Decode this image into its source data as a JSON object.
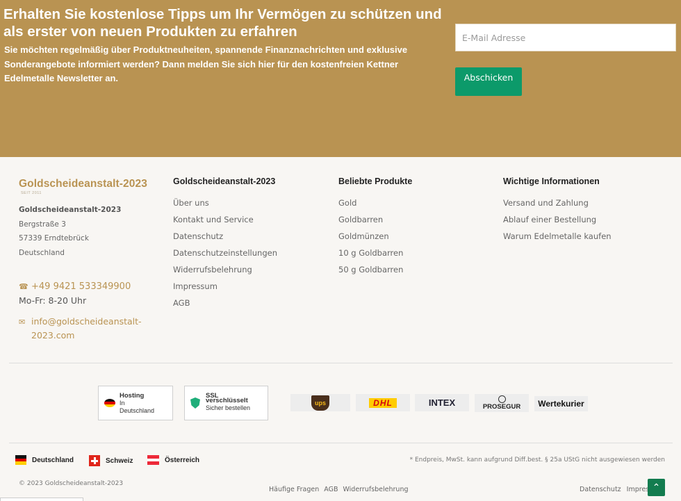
{
  "newsletter": {
    "title": "Erhalten Sie kostenlose Tipps um Ihr Vermögen zu schützen und als erster von neuen Produkten zu erfahren",
    "text": "Sie möchten regelmäßig über Produktneuheiten, spannende Finanznachrichten und exklusive Sonderangebote informiert werden? Dann melden Sie sich hier für den kostenfreien Kettner Edelmetalle Newsletter an.",
    "email_placeholder": "E-Mail Adresse",
    "submit_label": "Abschicken"
  },
  "brand": {
    "logo_name": "Goldscheideanstalt-2023",
    "logo_sub": "SEIT 2011",
    "company": "Goldscheideanstalt-2023",
    "street": "Bergstraße 3",
    "city": "57339 Erndtebrück",
    "country": "Deutschland",
    "phone": "+49 9421 533349900",
    "hours": "Mo-Fr: 8-20 Uhr",
    "email": "info@goldscheideanstalt-2023.com"
  },
  "columns": [
    {
      "title": "Goldscheideanstalt-2023",
      "links": [
        "Über uns",
        "Kontakt und Service",
        "Datenschutz",
        "Datenschutzeinstellungen",
        "Widerrufsbelehrung",
        "Impressum",
        "AGB"
      ]
    },
    {
      "title": "Beliebte Produkte",
      "links": [
        "Gold",
        "Goldbarren",
        "Goldmünzen",
        "10 g Goldbarren",
        "50 g Goldbarren"
      ]
    },
    {
      "title": "Wichtige Informationen",
      "links": [
        "Versand und Zahlung",
        "Ablauf einer Bestellung",
        "Warum Edelmetalle kaufen"
      ]
    }
  ],
  "badges": {
    "hosting": {
      "title": "Hosting",
      "line1": "In",
      "line2": "Deutschland"
    },
    "ssl": {
      "title": "SSL",
      "line1": "verschlüsselt",
      "line2": "Sicher bestellen"
    }
  },
  "shipping": {
    "ups": "ups",
    "dhl": "DHL",
    "intex": "INTEX",
    "prosegur": "PROSEGUR",
    "wertekurier": "Wertekurier"
  },
  "countries": [
    "Deutschland",
    "Schweiz",
    "Österreich"
  ],
  "disclaimer": "* Endpreis, MwSt. kann aufgrund Diff.best. § 25a UStG nicht ausgewiesen werden",
  "copyright": "© 2023 Goldscheideanstalt-2023",
  "bottom_links": [
    "Häufige Fragen",
    "AGB",
    "Widerrufsbelehrung"
  ],
  "bottom_right_links": [
    "Datenschutz",
    "Impressum"
  ],
  "colors": {
    "gold": "#b99352",
    "green": "#0c9a6a",
    "background": "#f8f6f3"
  }
}
